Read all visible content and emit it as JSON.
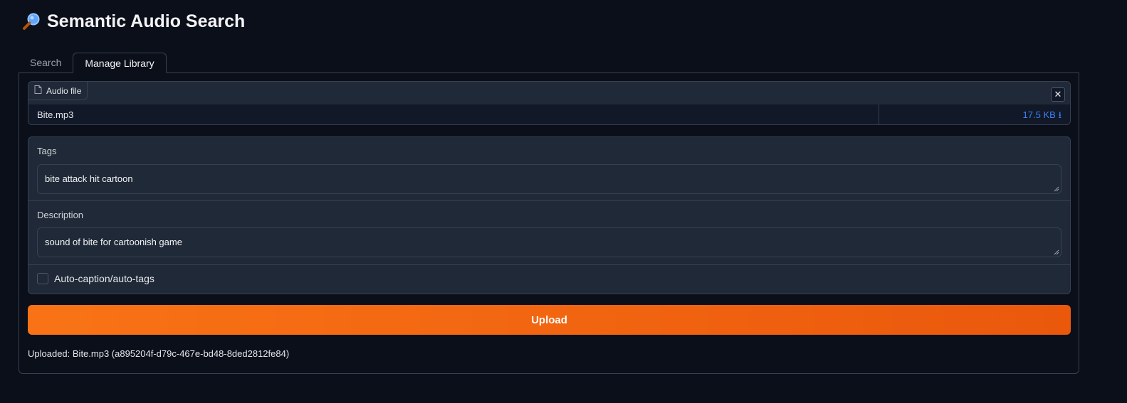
{
  "app": {
    "title": "Semantic Audio Search",
    "title_icon": "magnifying-glass-icon"
  },
  "tabs": [
    {
      "label": "Search",
      "active": false
    },
    {
      "label": "Manage Library",
      "active": true
    }
  ],
  "file": {
    "label": "Audio file",
    "label_icon": "file-icon",
    "name": "Bite.mp3",
    "size": "17.5 KB",
    "download_icon": "download-arrow-icon",
    "close_icon": "close-icon",
    "close_symbol": "✕"
  },
  "form": {
    "tags_label": "Tags",
    "tags_value": "bite attack hit cartoon",
    "description_label": "Description",
    "description_value": "sound of bite for cartoonish game",
    "auto_caption_label": "Auto-caption/auto-tags",
    "auto_caption_checked": false
  },
  "upload_button": "Upload",
  "status": "Uploaded: Bite.mp3 (a895204f-d79c-467e-bd48-8ded2812fe84)",
  "colors": {
    "background": "#0b0f19",
    "accent": "#f97316",
    "link": "#3b82f6"
  }
}
